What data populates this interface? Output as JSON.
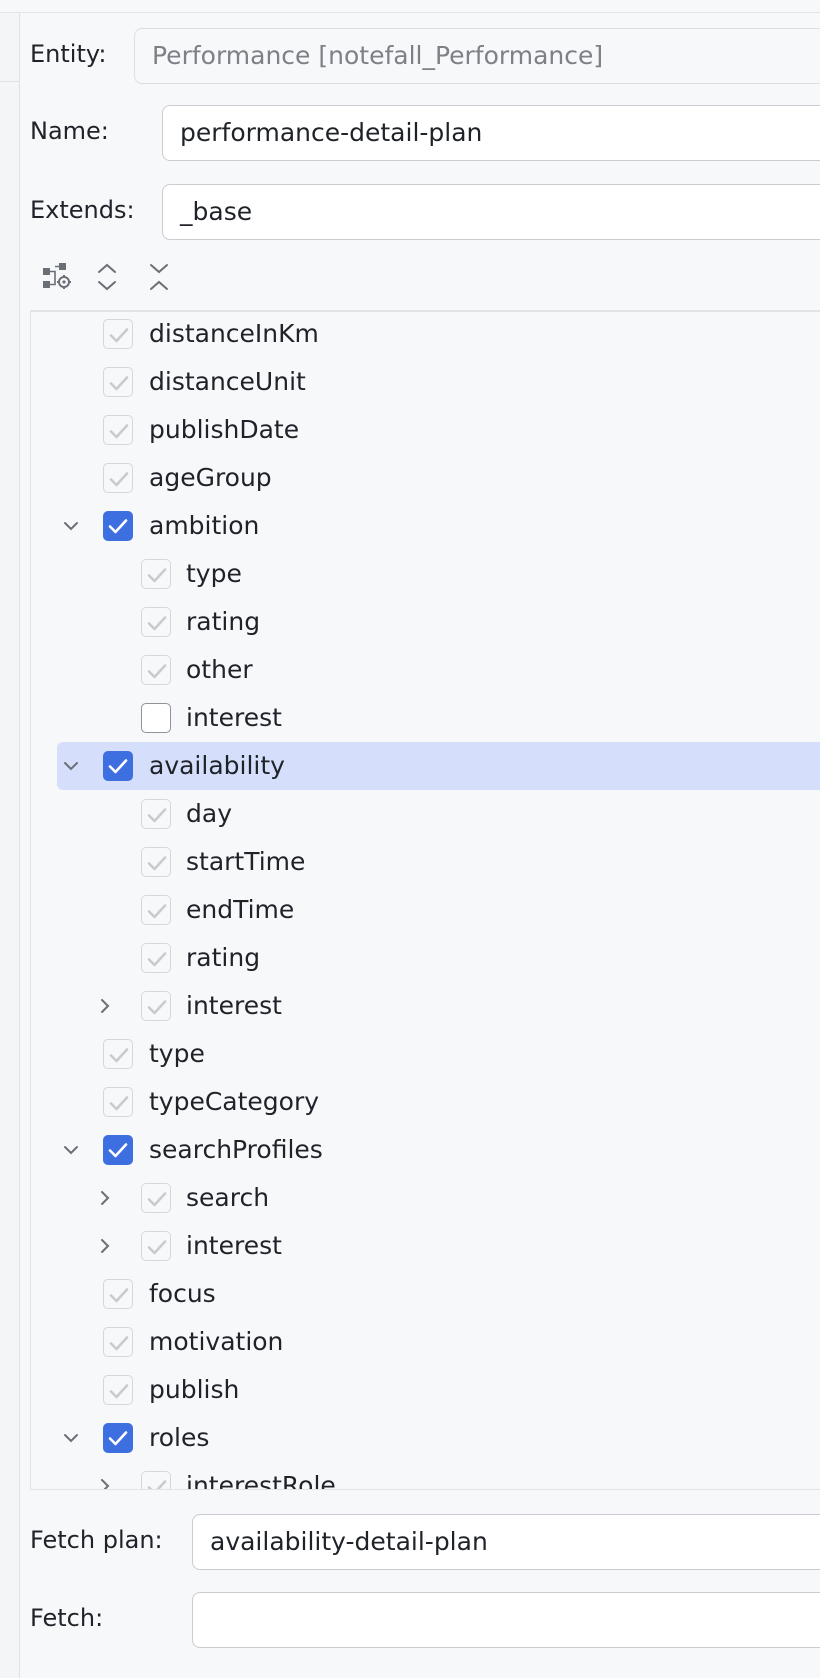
{
  "form": {
    "entity_label": "Entity:",
    "entity_value": "Performance [notefall_Performance]",
    "name_label": "Name:",
    "name_value": "performance-detail-plan",
    "extends_label": "Extends:",
    "extends_value": "_base",
    "fetch_plan_label": "Fetch plan:",
    "fetch_plan_value": "availability-detail-plan",
    "fetch_label": "Fetch:",
    "fetch_value": ""
  },
  "toolbar": {
    "icons": [
      "hierarchy-settings-icon",
      "expand-all-icon",
      "collapse-all-icon"
    ]
  },
  "tree": {
    "items": [
      {
        "label": "distanceInKm",
        "level": 1,
        "state": "disabled",
        "expander": "none"
      },
      {
        "label": "distanceUnit",
        "level": 1,
        "state": "disabled",
        "expander": "none"
      },
      {
        "label": "publishDate",
        "level": 1,
        "state": "disabled",
        "expander": "none"
      },
      {
        "label": "ageGroup",
        "level": 1,
        "state": "disabled",
        "expander": "none"
      },
      {
        "label": "ambition",
        "level": 1,
        "state": "checked",
        "expander": "expanded"
      },
      {
        "label": "type",
        "level": 2,
        "state": "disabled",
        "expander": "none"
      },
      {
        "label": "rating",
        "level": 2,
        "state": "disabled",
        "expander": "none"
      },
      {
        "label": "other",
        "level": 2,
        "state": "disabled",
        "expander": "none"
      },
      {
        "label": "interest",
        "level": 2,
        "state": "unchecked",
        "expander": "none"
      },
      {
        "label": "availability",
        "level": 1,
        "state": "checked",
        "expander": "expanded",
        "selected": true
      },
      {
        "label": "day",
        "level": 2,
        "state": "disabled",
        "expander": "none"
      },
      {
        "label": "startTime",
        "level": 2,
        "state": "disabled",
        "expander": "none"
      },
      {
        "label": "endTime",
        "level": 2,
        "state": "disabled",
        "expander": "none"
      },
      {
        "label": "rating",
        "level": 2,
        "state": "disabled",
        "expander": "none"
      },
      {
        "label": "interest",
        "level": 2,
        "state": "disabled",
        "expander": "collapsed"
      },
      {
        "label": "type",
        "level": 1,
        "state": "disabled",
        "expander": "none"
      },
      {
        "label": "typeCategory",
        "level": 1,
        "state": "disabled",
        "expander": "none"
      },
      {
        "label": "searchProfiles",
        "level": 1,
        "state": "checked",
        "expander": "expanded"
      },
      {
        "label": "search",
        "level": 2,
        "state": "disabled",
        "expander": "collapsed"
      },
      {
        "label": "interest",
        "level": 2,
        "state": "disabled",
        "expander": "collapsed"
      },
      {
        "label": "focus",
        "level": 1,
        "state": "disabled",
        "expander": "none"
      },
      {
        "label": "motivation",
        "level": 1,
        "state": "disabled",
        "expander": "none"
      },
      {
        "label": "publish",
        "level": 1,
        "state": "disabled",
        "expander": "none"
      },
      {
        "label": "roles",
        "level": 1,
        "state": "checked",
        "expander": "expanded"
      },
      {
        "label": "interestRole",
        "level": 2,
        "state": "disabled",
        "expander": "collapsed"
      }
    ]
  },
  "colors": {
    "accent": "#3e6fe0",
    "selection": "#d5defa",
    "background": "#f7f8fa"
  }
}
